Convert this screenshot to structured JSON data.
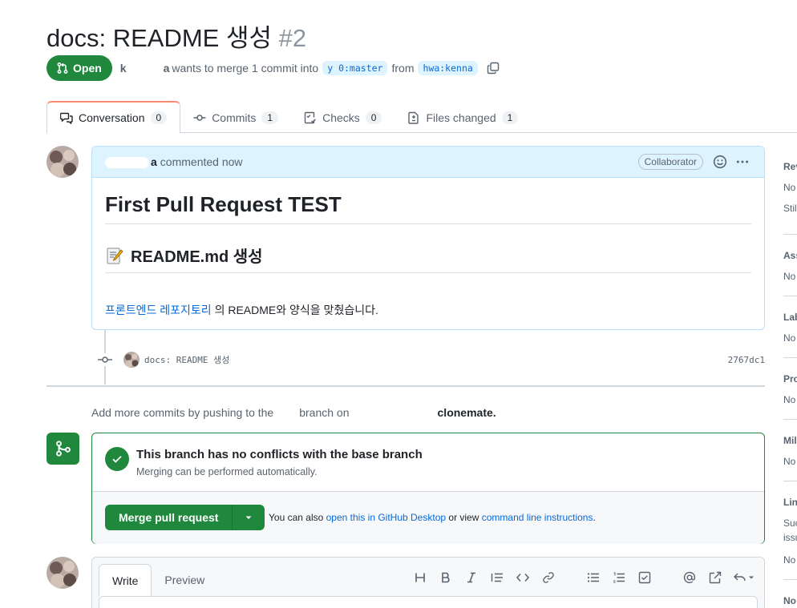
{
  "pr": {
    "title": "docs: README 생성",
    "number": "#2",
    "state": "Open",
    "author_fragment": "k",
    "author_suffix": "a",
    "merge_text": "wants to merge 1 commit into",
    "base_branch": "y      0:master",
    "from_text": "from",
    "head_branch": "   hwa:kenna"
  },
  "tabs": [
    {
      "label": "Conversation",
      "count": "0"
    },
    {
      "label": "Commits",
      "count": "1"
    },
    {
      "label": "Checks",
      "count": "0"
    },
    {
      "label": "Files changed",
      "count": "1"
    }
  ],
  "comment": {
    "author_suffix": "a",
    "action": "commented now",
    "role": "Collaborator",
    "heading1": "First Pull Request TEST",
    "heading2": "README.md 생성",
    "link_text": "프론트엔드 레포지토리",
    "body_text": "의 README와 양식을 맞췄습니다."
  },
  "commit": {
    "message": "docs: README 생성",
    "sha": "2767dc1"
  },
  "hint": {
    "prefix": "Add more commits by pushing to the",
    "middle": "branch on",
    "suffix": "clonemate."
  },
  "merge": {
    "title": "This branch has no conflicts with the base branch",
    "subtitle": "Merging can be performed automatically.",
    "button": "Merge pull request",
    "alt_prefix": "You can also",
    "alt_link1": "open this in GitHub Desktop",
    "alt_middle": "or view",
    "alt_link2": "command line instructions",
    "alt_suffix": "."
  },
  "editor": {
    "write_tab": "Write",
    "preview_tab": "Preview",
    "toolbar_icons": [
      "heading-icon",
      "bold-icon",
      "italic-icon",
      "quote-icon",
      "code-icon",
      "link-icon",
      "unordered-list-icon",
      "ordered-list-icon",
      "task-list-icon",
      "mention-icon",
      "reference-icon",
      "reply-icon"
    ]
  },
  "sidebar": {
    "items": [
      {
        "head": "Rev",
        "text1": "No",
        "text2": "Stil"
      },
      {
        "head": "Ass",
        "text1": "No"
      },
      {
        "head": "Lab",
        "text1": "No"
      },
      {
        "head": "Pro",
        "text1": "No"
      },
      {
        "head": "Mil",
        "text1": "No"
      },
      {
        "head": "Lin",
        "text1": "Suc",
        "text2": "issu",
        "text3": "No"
      },
      {
        "head": "No"
      }
    ]
  },
  "colors": {
    "accent_green": "#1f883d",
    "link_blue": "#0969da",
    "comment_header_bg": "#ddf4ff",
    "tab_underline": "#fd8c73"
  }
}
